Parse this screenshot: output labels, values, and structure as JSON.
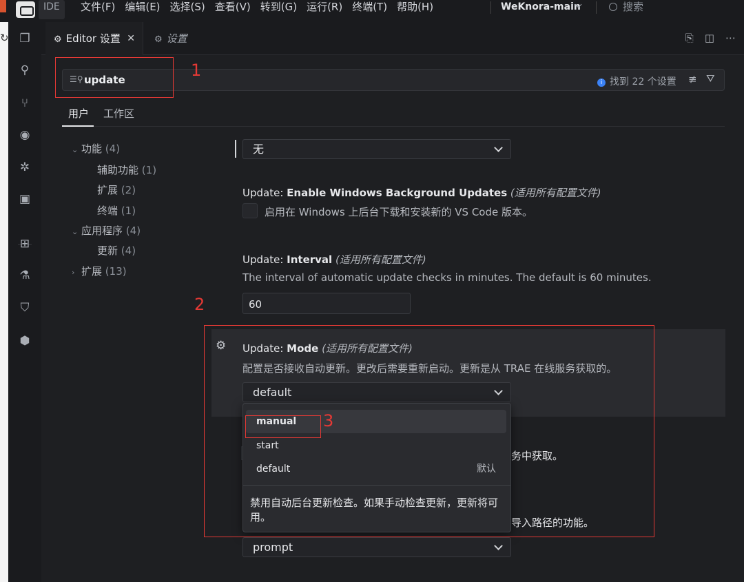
{
  "titlebar": {
    "ide_label": "IDE",
    "menu": [
      "文件(F)",
      "编辑(E)",
      "选择(S)",
      "查看(V)",
      "转到(G)",
      "运行(R)",
      "终端(T)",
      "帮助(H)"
    ],
    "project": "WeKnora-main",
    "search_placeholder": "搜索"
  },
  "tabs": {
    "active": "Editor 设置",
    "inactive": "设置"
  },
  "search": {
    "value": "update",
    "result": "找到 22 个设置"
  },
  "scope": {
    "user": "用户",
    "workspace": "工作区"
  },
  "tree": [
    {
      "label": "功能",
      "count": "(4)",
      "expanded": true,
      "level": 0
    },
    {
      "label": "辅助功能",
      "count": "(1)",
      "level": 1
    },
    {
      "label": "扩展",
      "count": "(2)",
      "level": 1
    },
    {
      "label": "终端",
      "count": "(1)",
      "level": 1
    },
    {
      "label": "应用程序",
      "count": "(4)",
      "expanded": true,
      "level": 0
    },
    {
      "label": "更新",
      "count": "(4)",
      "level": 1
    },
    {
      "label": "扩展",
      "count": "(13)",
      "expanded": false,
      "level": 0
    }
  ],
  "settings": {
    "top_select": "无",
    "bg_updates": {
      "prefix": "Update: ",
      "name": "Enable Windows Background Updates",
      "scope": "(适用所有配置文件)",
      "desc": "启用在 Windows 上后台下载和安装新的 VS Code 版本。"
    },
    "interval": {
      "prefix": "Update: ",
      "name": "Interval",
      "scope": "(适用所有配置文件)",
      "desc": "The interval of automatic update checks in minutes. The default is 60 minutes.",
      "value": "60"
    },
    "mode": {
      "prefix": "Update: ",
      "name": "Mode",
      "scope": "(适用所有配置文件)",
      "desc": "配置是否接收自动更新。更改后需要重新启动。更新是从 TRAE 在线服务获取的。",
      "value": "default",
      "options": [
        {
          "label": "manual",
          "hovered": true
        },
        {
          "label": "start"
        },
        {
          "label": "default",
          "tag": "默认"
        }
      ],
      "option_desc": "禁用自动后台更新检查。如果手动检查更新，更新将可用。"
    },
    "behind_text_1": "务中获取。",
    "behind_text_2": "导入路径的功能。",
    "bottom_select": "prompt"
  },
  "annotations": [
    "1",
    "2",
    "3"
  ],
  "colors": {
    "annotation_red": "#e53935",
    "info_blue": "#3b82f6"
  }
}
